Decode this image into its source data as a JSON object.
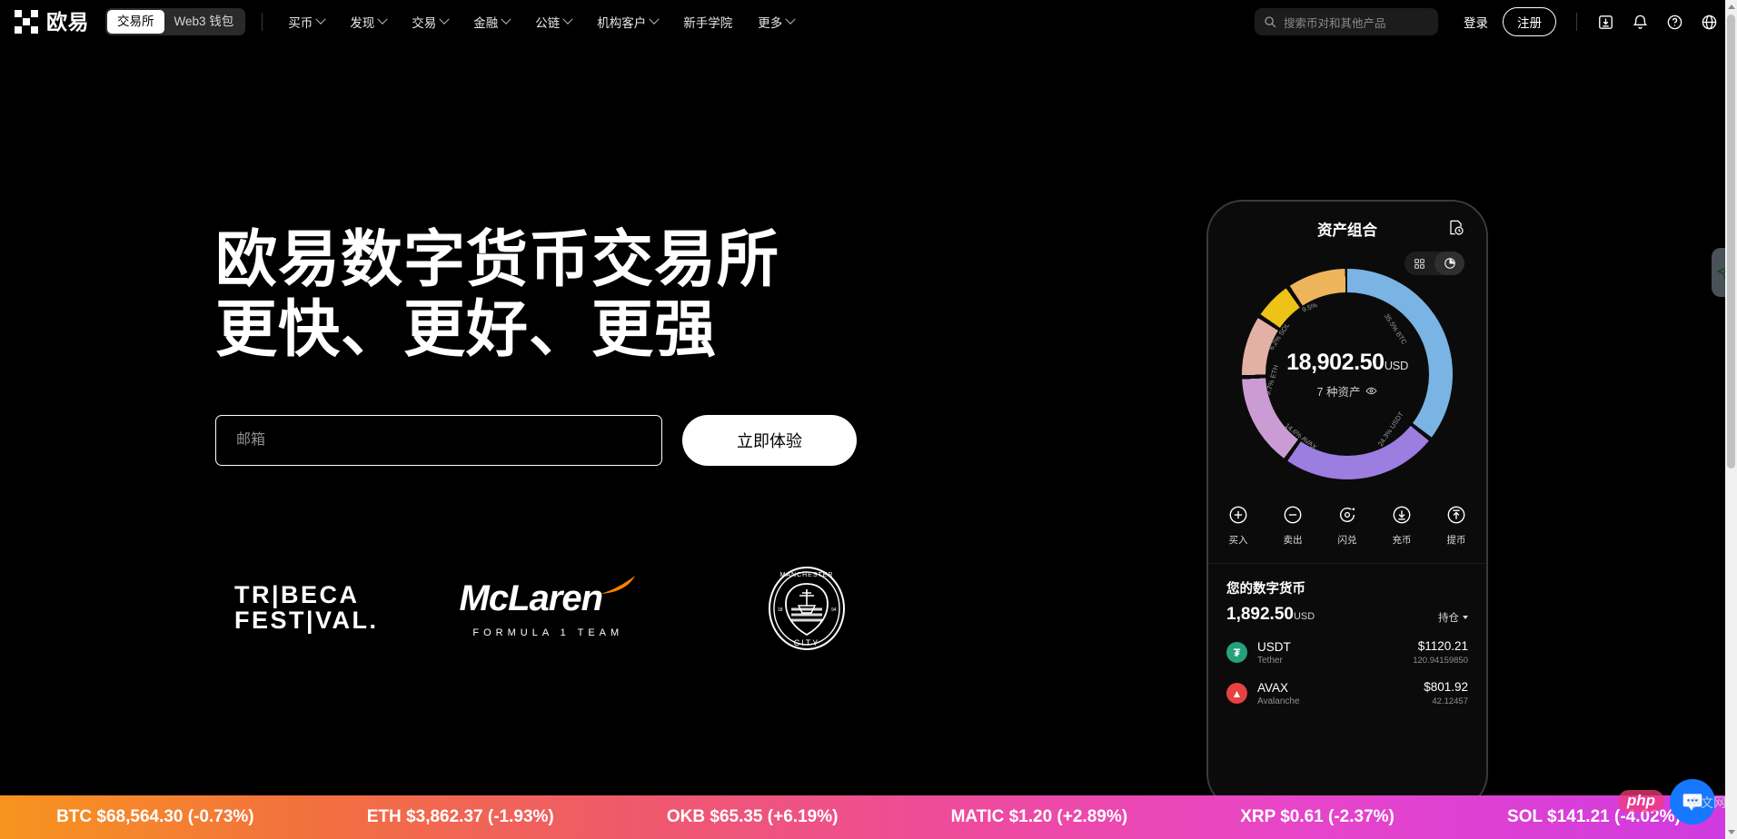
{
  "nav": {
    "brand": "欧易",
    "segments": [
      {
        "label": "交易所",
        "active": true
      },
      {
        "label": "Web3 钱包",
        "active": false
      }
    ],
    "links": [
      {
        "label": "买币",
        "caret": true
      },
      {
        "label": "发现",
        "caret": true
      },
      {
        "label": "交易",
        "caret": true
      },
      {
        "label": "金融",
        "caret": true
      },
      {
        "label": "公链",
        "caret": true
      },
      {
        "label": "机构客户",
        "caret": true
      },
      {
        "label": "新手学院",
        "caret": false
      },
      {
        "label": "更多",
        "caret": true
      }
    ],
    "search_placeholder": "搜索币对和其他产品",
    "login_label": "登录",
    "register_label": "注册",
    "icons": [
      "download-icon",
      "bell-icon",
      "help-icon",
      "globe-icon"
    ]
  },
  "hero": {
    "headline": "欧易数字货币交易所\n更快、更好、更强",
    "email_placeholder": "邮箱",
    "email_value": "",
    "cta_label": "立即体验",
    "sponsors": [
      {
        "name": "tribeca-festival-logo",
        "line1": "TR|BECA",
        "line2": "FEST|VAL."
      },
      {
        "name": "mclaren-logo",
        "title": "McLaren",
        "subtitle": "FORMULA 1 TEAM"
      },
      {
        "name": "manchester-city-logo",
        "top": "MANCHESTER",
        "bottom": "CITY",
        "years": [
          "18",
          "94"
        ]
      }
    ]
  },
  "phone": {
    "title": "资产组合",
    "total_value": "18,902.50",
    "currency": "USD",
    "assets_count_label": "7 种资产",
    "actions": [
      {
        "label": "买入",
        "icon": "plus-circle-icon"
      },
      {
        "label": "卖出",
        "icon": "minus-circle-icon"
      },
      {
        "label": "闪兑",
        "icon": "swap-circle-icon"
      },
      {
        "label": "充币",
        "icon": "deposit-icon"
      },
      {
        "label": "提币",
        "icon": "withdraw-icon"
      }
    ],
    "holdings": {
      "title": "您的数字货币",
      "amount": "1,892.50",
      "currency": "USD",
      "filter_label": "持仓",
      "coins": [
        {
          "symbol": "USDT",
          "name": "Tether",
          "value": "$1120.21",
          "qty": "120.94159850",
          "color": "#26a17b",
          "glyph": "₮"
        },
        {
          "symbol": "AVAX",
          "name": "Avalanche",
          "value": "$801.92",
          "qty": "42.12457",
          "color": "#e84142",
          "glyph": "▲"
        }
      ]
    }
  },
  "chart_data": {
    "type": "pie",
    "title": "资产组合",
    "center_value": "18,902.50 USD",
    "center_sub": "7 种资产",
    "labels": [
      "35.5% BTC",
      "24.3% USDT",
      "14.6% AVAX",
      "9.7% ETH",
      "6.2% SOL",
      "9.5%"
    ],
    "categories": [
      "BTC",
      "USDT",
      "AVAX",
      "ETH",
      "SOL",
      "Other"
    ],
    "values": [
      35.5,
      24.3,
      14.6,
      9.7,
      6.2,
      9.5
    ],
    "colors": [
      "#79b4e5",
      "#9b7ee0",
      "#cb9cd4",
      "#e3b0a5",
      "#ecc316",
      "#edb45c"
    ],
    "legend": "on-slice",
    "unit": "%"
  },
  "ticker": {
    "items": [
      {
        "symbol": "BTC",
        "price": "$68,564.30",
        "change": "(-0.73%)"
      },
      {
        "symbol": "ETH",
        "price": "$3,862.37",
        "change": "(-1.93%)"
      },
      {
        "symbol": "OKB",
        "price": "$65.35",
        "change": "(+6.19%)"
      },
      {
        "symbol": "MATIC",
        "price": "$1.20",
        "change": "(+2.89%)"
      },
      {
        "symbol": "XRP",
        "price": "$0.61",
        "change": "(-2.37%)"
      },
      {
        "symbol": "SOL",
        "price": "$141.21",
        "change": "(-4.02%)"
      }
    ]
  },
  "floaters": {
    "telegram_icon": "paper-plane-icon",
    "chat_icon": "chat-bubble-icon"
  },
  "watermark": {
    "php": "php",
    "cn": "中文网"
  },
  "colors": {
    "accent_white": "#ffffff",
    "ticker_start": "#f7941e",
    "ticker_end": "#cf3ae0",
    "chat_blue": "#1677ff"
  }
}
